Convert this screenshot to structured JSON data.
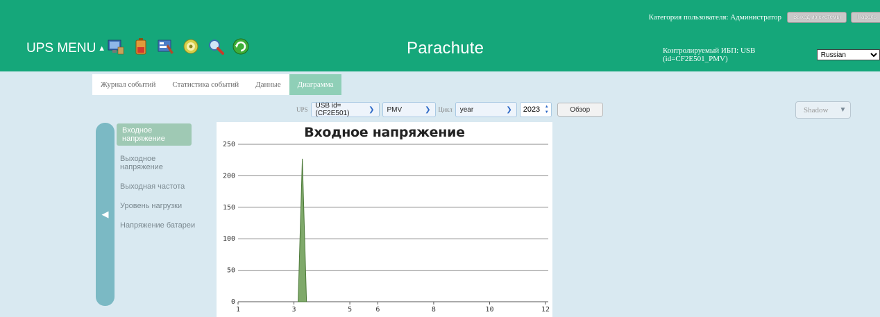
{
  "header": {
    "user_category": "Категория пользователя: Администратор",
    "logout_label": "Выход из системы",
    "password_label": "Пароль",
    "menu_title": "UPS MENU",
    "menu_caret": "▲",
    "app_title": "Parachute",
    "monitored_ups": "Контролируемый ИБП: USB (id=CF2E501_PMV)",
    "language": "Russian",
    "icons": [
      "monitor-icon",
      "battery-icon",
      "settings-icon",
      "disk-icon",
      "search-icon",
      "refresh-icon"
    ],
    "bg_color": "#15a77a"
  },
  "tabs": [
    {
      "label": "Журнал событий",
      "active": false
    },
    {
      "label": "Статистика событий",
      "active": false
    },
    {
      "label": "Данные",
      "active": false
    },
    {
      "label": "Диаграмма",
      "active": true
    }
  ],
  "filters": {
    "ups_label": "UPS",
    "ups_value": "USB id=(CF2E501)",
    "param_value": "PMV",
    "cycle_label": "Цикл",
    "cycle_value": "year",
    "year_value": "2023",
    "browse_label": "Обзор",
    "shadow_value": "Shadow"
  },
  "side_menu": {
    "toggle_glyph": "◀",
    "items": [
      {
        "label": "Входное напряжение",
        "active": true
      },
      {
        "label": "Выходное напряжение",
        "active": false
      },
      {
        "label": "Выходная частота",
        "active": false
      },
      {
        "label": "Уровень нагрузки",
        "active": false
      },
      {
        "label": "Напряжение батареи",
        "active": false
      }
    ]
  },
  "chart_data": {
    "type": "area",
    "title": "Входное напряжение",
    "xlabel": "",
    "ylabel": "",
    "x_ticks": [
      1,
      3,
      5,
      6,
      8,
      10,
      12
    ],
    "y_ticks": [
      0,
      50,
      100,
      150,
      200,
      250
    ],
    "xlim": [
      1,
      12
    ],
    "ylim": [
      0,
      250
    ],
    "grid": "horizontal",
    "series": [
      {
        "x": [
          3.15,
          3.3,
          3.45
        ],
        "values": [
          0,
          227,
          0
        ],
        "color": "#7fa96a"
      }
    ]
  }
}
